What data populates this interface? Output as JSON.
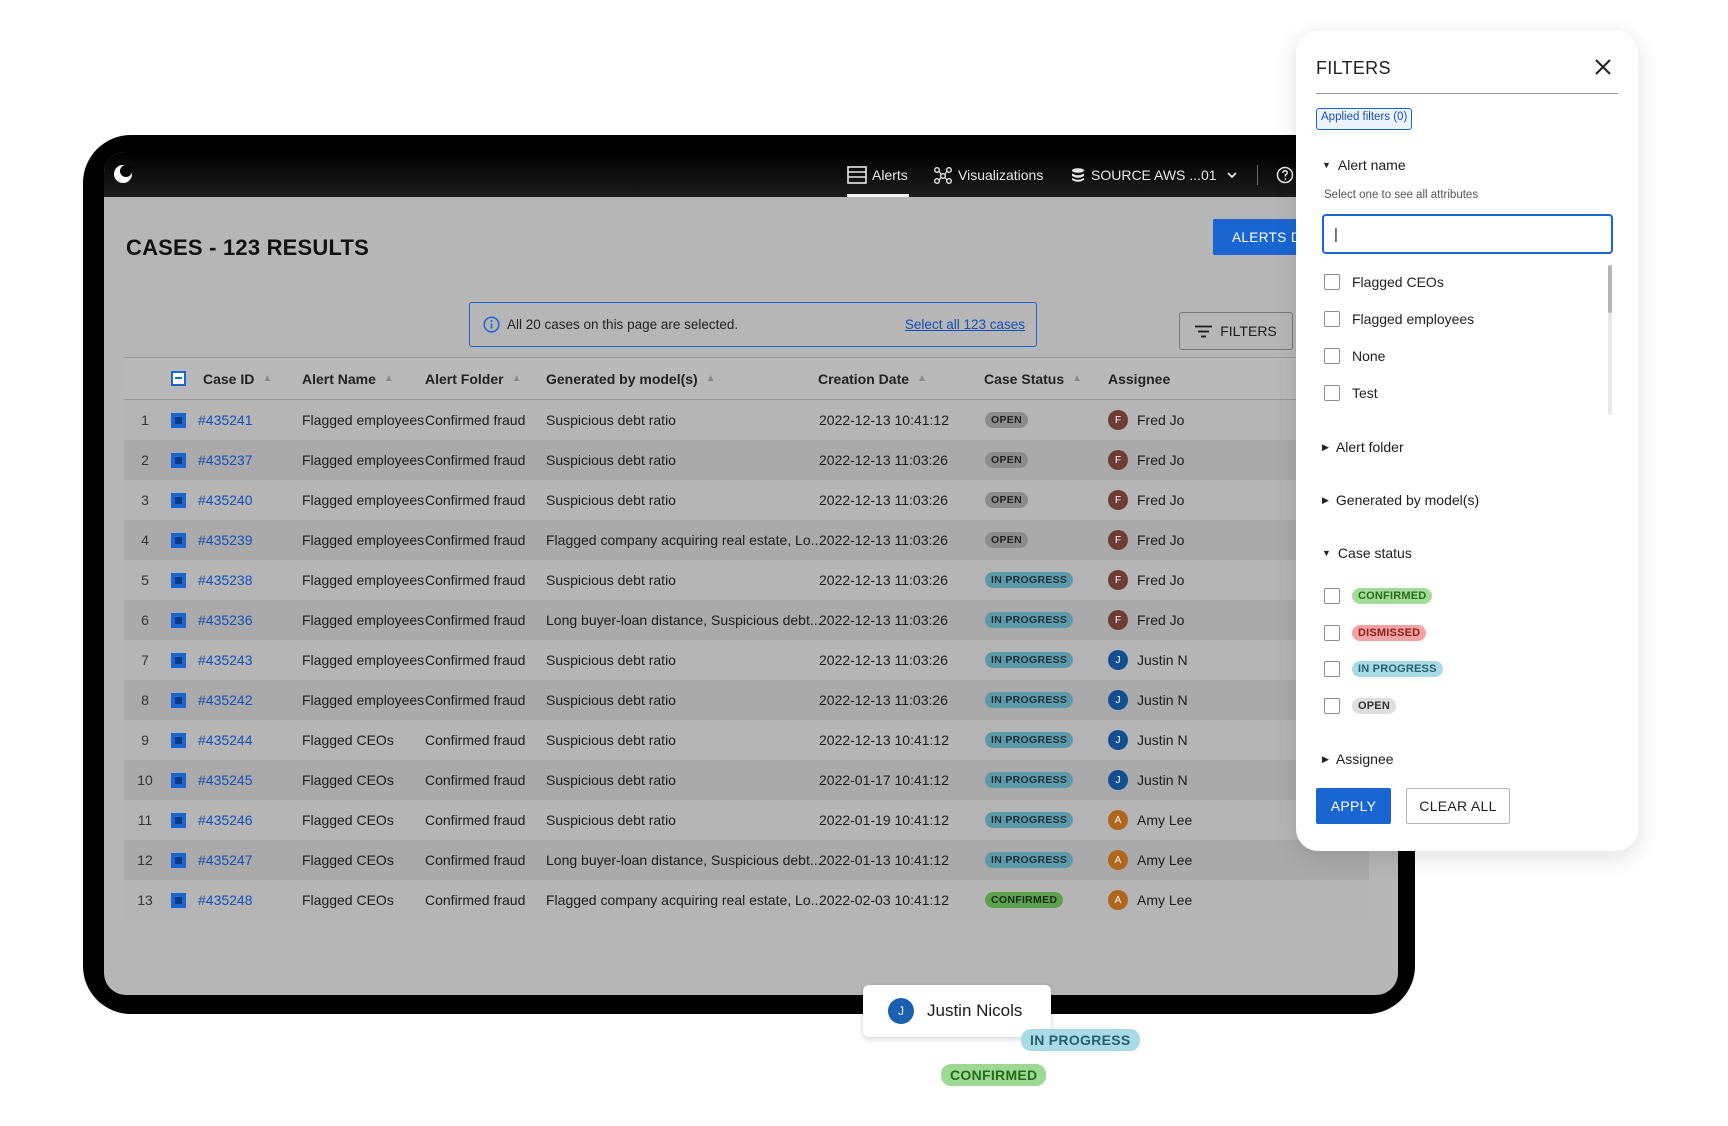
{
  "topbar": {
    "nav_alerts": "Alerts",
    "nav_visualizations": "Visualizations",
    "nav_source": "SOURCE AWS ...01"
  },
  "page": {
    "title": "CASES - 123 RESULTS",
    "alerts_button": "ALERTS DA",
    "selection_message": "All 20 cases on this page are selected.",
    "select_all_link": "Select all 123 cases",
    "filters_button": "FILTERS"
  },
  "table": {
    "columns": [
      "Case ID",
      "Alert Name",
      "Alert Folder",
      "Generated by model(s)",
      "Creation Date",
      "Case Status",
      "Assignee"
    ],
    "rows": [
      {
        "num": "1",
        "case_id": "#435241",
        "alert_name": "Flagged employees",
        "folder": "Confirmed fraud",
        "model": "Suspicious debt ratio",
        "date": "2022-12-13 10:41:12",
        "status": "OPEN",
        "initial": "F",
        "assignee": "Fred Jo"
      },
      {
        "num": "2",
        "case_id": "#435237",
        "alert_name": "Flagged employees",
        "folder": "Confirmed fraud",
        "model": "Suspicious debt ratio",
        "date": "2022-12-13 11:03:26",
        "status": "OPEN",
        "initial": "F",
        "assignee": "Fred Jo"
      },
      {
        "num": "3",
        "case_id": "#435240",
        "alert_name": "Flagged employees",
        "folder": "Confirmed fraud",
        "model": "Suspicious debt ratio",
        "date": "2022-12-13 11:03:26",
        "status": "OPEN",
        "initial": "F",
        "assignee": "Fred Jo"
      },
      {
        "num": "4",
        "case_id": "#435239",
        "alert_name": "Flagged employees",
        "folder": "Confirmed fraud",
        "model": "Flagged company acquiring real estate, Lo...",
        "date": "2022-12-13 11:03:26",
        "status": "OPEN",
        "initial": "F",
        "assignee": "Fred Jo"
      },
      {
        "num": "5",
        "case_id": "#435238",
        "alert_name": "Flagged employees",
        "folder": "Confirmed fraud",
        "model": "Suspicious debt ratio",
        "date": "2022-12-13 11:03:26",
        "status": "IN PROGRESS",
        "initial": "F",
        "assignee": "Fred Jo"
      },
      {
        "num": "6",
        "case_id": "#435236",
        "alert_name": "Flagged employees",
        "folder": "Confirmed fraud",
        "model": "Long buyer-loan distance, Suspicious debt...",
        "date": "2022-12-13 11:03:26",
        "status": "IN PROGRESS",
        "initial": "F",
        "assignee": "Fred Jo"
      },
      {
        "num": "7",
        "case_id": "#435243",
        "alert_name": "Flagged employees",
        "folder": "Confirmed fraud",
        "model": "Suspicious debt ratio",
        "date": "2022-12-13 11:03:26",
        "status": "IN PROGRESS",
        "initial": "J",
        "assignee": "Justin N"
      },
      {
        "num": "8",
        "case_id": "#435242",
        "alert_name": "Flagged employees",
        "folder": "Confirmed fraud",
        "model": "Suspicious debt ratio",
        "date": "2022-12-13 11:03:26",
        "status": "IN PROGRESS",
        "initial": "J",
        "assignee": "Justin N"
      },
      {
        "num": "9",
        "case_id": "#435244",
        "alert_name": "Flagged CEOs",
        "folder": "Confirmed fraud",
        "model": "Suspicious debt ratio",
        "date": "2022-12-13 10:41:12",
        "status": "IN PROGRESS",
        "initial": "J",
        "assignee": "Justin N"
      },
      {
        "num": "10",
        "case_id": "#435245",
        "alert_name": "Flagged CEOs",
        "folder": "Confirmed fraud",
        "model": "Suspicious debt ratio",
        "date": "2022-01-17 10:41:12",
        "status": "IN PROGRESS",
        "initial": "J",
        "assignee": "Justin N"
      },
      {
        "num": "11",
        "case_id": "#435246",
        "alert_name": "Flagged CEOs",
        "folder": "Confirmed fraud",
        "model": "Suspicious debt ratio",
        "date": "2022-01-19 10:41:12",
        "status": "IN PROGRESS",
        "initial": "A",
        "assignee": "Amy Lee"
      },
      {
        "num": "12",
        "case_id": "#435247",
        "alert_name": "Flagged CEOs",
        "folder": "Confirmed fraud",
        "model": "Long buyer-loan distance, Suspicious debt...",
        "date": "2022-01-13 10:41:12",
        "status": "IN PROGRESS",
        "initial": "A",
        "assignee": "Amy Lee"
      },
      {
        "num": "13",
        "case_id": "#435248",
        "alert_name": "Flagged CEOs",
        "folder": "Confirmed fraud",
        "model": "Flagged company acquiring real estate, Lo...",
        "date": "2022-02-03 10:41:12",
        "status": "CONFIRMED",
        "initial": "A",
        "assignee": "Amy Lee"
      }
    ]
  },
  "floating": {
    "assignee_initial": "J",
    "assignee_name": "Justin Nicols",
    "status_in_progress": "IN PROGRESS",
    "status_confirmed": "CONFIRMED"
  },
  "filters_panel": {
    "title": "FILTERS",
    "applied": "Applied filters (0)",
    "alert_name_section": "Alert name",
    "hint": "Select one to see all attributes",
    "search_value": "|",
    "alert_name_options": [
      "Flagged CEOs",
      "Flagged employees",
      "None",
      "Test"
    ],
    "alert_folder_section": "Alert folder",
    "model_section": "Generated by model(s)",
    "case_status_section": "Case status",
    "case_status_options": [
      "CONFIRMED",
      "DISMISSED",
      "IN PROGRESS",
      "OPEN"
    ],
    "assignee_section": "Assignee",
    "apply": "APPLY",
    "clear_all": "CLEAR ALL"
  },
  "colors": {
    "accent": "#1966d2",
    "link": "#1450b8",
    "confirmed": "#a3dc98",
    "dismissed": "#f3a3a3",
    "in_progress": "#a9dbe6",
    "open": "#dedede"
  }
}
